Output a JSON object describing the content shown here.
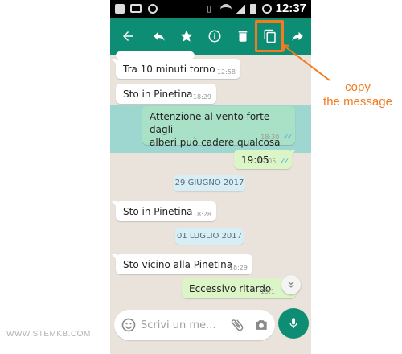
{
  "status_bar": {
    "time": "12:37",
    "icons": [
      "facebook-icon",
      "image-icon",
      "recycle-icon",
      "vibrate-icon",
      "wifi-icon",
      "signal-icon",
      "battery-icon",
      "alarm-icon"
    ]
  },
  "action_bar": {
    "color": "#0e8d75",
    "buttons": [
      "back-arrow-icon",
      "reply-icon",
      "star-icon",
      "info-icon",
      "delete-icon",
      "copy-icon",
      "forward-icon"
    ]
  },
  "annotation": {
    "line1": "copy",
    "line2": "the message",
    "color": "#f47a1f"
  },
  "messages": [
    {
      "direction": "in",
      "text": "Tra 10 minuti torno",
      "time": "12:58"
    },
    {
      "direction": "in",
      "text": "Sto in Pinetina",
      "time": "18:29"
    },
    {
      "direction": "out",
      "selected": true,
      "text_line1": "Attenzione al vento forte dagli",
      "text_line2": "alberi può cadere qualcosa",
      "time": "18:30",
      "ticks": "✓✓"
    },
    {
      "direction": "out",
      "text": "19:05",
      "time": "19:05",
      "ticks": "✓✓"
    },
    {
      "type": "date",
      "text": "29 GIUGNO 2017"
    },
    {
      "direction": "in",
      "text": "Sto in Pinetina",
      "time": "18:28"
    },
    {
      "type": "date",
      "text": "01 LUGLIO 2017"
    },
    {
      "direction": "in",
      "text": "Sto vicino alla Pinetina",
      "time": "18:29"
    },
    {
      "direction": "out",
      "text": "Eccessivo ritardo",
      "time": "19:1"
    }
  ],
  "input": {
    "placeholder": "Scrivi un me...",
    "value": ""
  },
  "watermark": "WWW.STEMKB.COM"
}
